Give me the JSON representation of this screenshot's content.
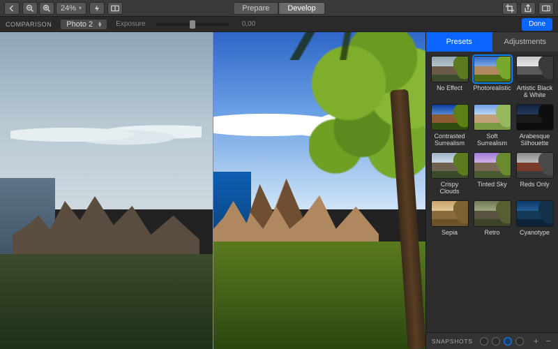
{
  "toolbar": {
    "zoom_percent": "24%",
    "mode_tabs": {
      "prepare": "Prepare",
      "develop": "Develop",
      "active": "develop"
    }
  },
  "subbar": {
    "comparison_label": "COMPARISON",
    "compare_select": "Photo 2",
    "slider_label": "Exposure",
    "slider_value": "0,00",
    "done_label": "Done"
  },
  "panel": {
    "tabs": {
      "presets": "Presets",
      "adjustments": "Adjustments",
      "active": "presets"
    },
    "selected_preset_index": 1,
    "presets": [
      {
        "label": "No Effect",
        "sky": "linear-gradient(#8fa3b0,#c6d2d8)",
        "mtn": "#6a5a4a",
        "fg": "#3c4a2c",
        "leaf": "#5c7a1e"
      },
      {
        "label": "Photorealistic",
        "sky": "linear-gradient(#2f66c8,#9cc4ef)",
        "mtn": "#b08860",
        "fg": "#4f6e14",
        "leaf": "#77a92a"
      },
      {
        "label": "Artistic Black & White",
        "sky": "linear-gradient(#c9c9c9,#efefef)",
        "mtn": "#5a5a5a",
        "fg": "#2b2b2b",
        "leaf": "#3a3a3a"
      },
      {
        "label": "Contrasted Surrealism",
        "sky": "linear-gradient(#0b3da1,#6fa0e6)",
        "mtn": "#8b5a30",
        "fg": "#2e4d0e",
        "leaf": "#5c8014"
      },
      {
        "label": "Soft Surrealism",
        "sky": "linear-gradient(#6fa0e6,#d7e9f7)",
        "mtn": "#c2a079",
        "fg": "#7a9a46",
        "leaf": "#94b85a"
      },
      {
        "label": "Arabesque Silhouette",
        "sky": "linear-gradient(#12203a,#2c4368)",
        "mtn": "#1a1a1a",
        "fg": "#0d0d0d",
        "leaf": "#0e0e0e"
      },
      {
        "label": "Crispy Clouds",
        "sky": "linear-gradient(#9fb4c6,#dde7ee)",
        "mtn": "#6e614f",
        "fg": "#3c4a2c",
        "leaf": "#5c7a1e"
      },
      {
        "label": "Tinted Sky",
        "sky": "linear-gradient(#a07ad6,#e3c6ef)",
        "mtn": "#7a6a55",
        "fg": "#4a5a30",
        "leaf": "#6a8a2e"
      },
      {
        "label": "Reds Only",
        "sky": "linear-gradient(#8a8a8a,#cfcfcf)",
        "mtn": "#7a3a2a",
        "fg": "#3a3a3a",
        "leaf": "#4a4a4a"
      },
      {
        "label": "Sepia",
        "sky": "linear-gradient(#caa46a,#e9d5a6)",
        "mtn": "#8a6b3c",
        "fg": "#6a5326",
        "leaf": "#7a6330"
      },
      {
        "label": "Retro",
        "sky": "linear-gradient(#6f7a5a,#b0b68a)",
        "mtn": "#5a5240",
        "fg": "#3e4228",
        "leaf": "#565e32"
      },
      {
        "label": "Cyanotype",
        "sky": "linear-gradient(#0d3a6a,#2d6aa8)",
        "mtn": "#143a5a",
        "fg": "#0d2438",
        "leaf": "#123248"
      }
    ]
  },
  "snapshots": {
    "label": "SNAPSHOTS",
    "count": 4,
    "active_index": 2
  },
  "colors": {
    "accent": "#0a66ff"
  }
}
